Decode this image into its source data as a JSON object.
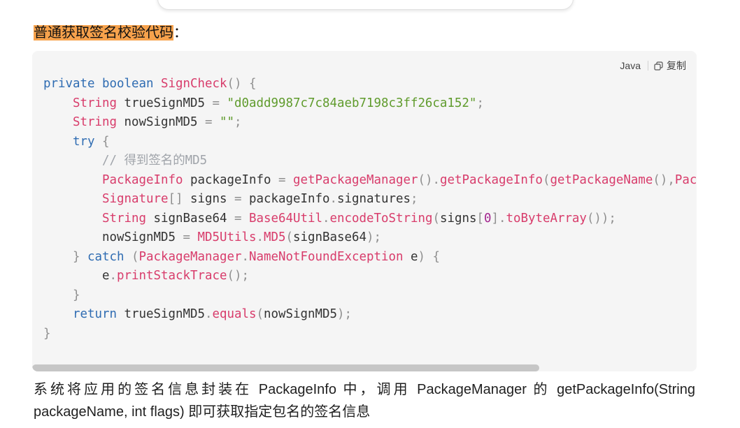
{
  "heading": {
    "highlighted": "普通获取签名校验代码",
    "suffix": "："
  },
  "colors": {
    "heading_highlight": "#f7a24c",
    "code_background": "#f5f5f5",
    "scrollbar_thumb": "#c6c6c6"
  },
  "code_block": {
    "language": "Java",
    "copy_label": "复制",
    "copy_icon": "copy-icon",
    "scroll": {
      "visible_fraction": 0.763,
      "scroll_position": 0
    },
    "lines": [
      [
        [
          "private",
          "#2f6cb2"
        ],
        [
          " ",
          "#333333"
        ],
        [
          "boolean",
          "#2f6cb2"
        ],
        [
          " ",
          "#333333"
        ],
        [
          "SignCheck",
          "#d83c6b"
        ],
        [
          "()",
          "#8f8f8f"
        ],
        [
          " ",
          "#333333"
        ],
        [
          "{",
          "#8f8f8f"
        ]
      ],
      [
        [
          "    ",
          "#333333"
        ],
        [
          "String",
          "#d83c6b"
        ],
        [
          " trueSignMD5 ",
          "#333333"
        ],
        [
          "=",
          "#8f8f8f"
        ],
        [
          " ",
          "#333333"
        ],
        [
          "\"d0add9987c7c84aeb7198c3ff26ca152\"",
          "#5f9b2c"
        ],
        [
          ";",
          "#8f8f8f"
        ]
      ],
      [
        [
          "    ",
          "#333333"
        ],
        [
          "String",
          "#d83c6b"
        ],
        [
          " nowSignMD5 ",
          "#333333"
        ],
        [
          "=",
          "#8f8f8f"
        ],
        [
          " ",
          "#333333"
        ],
        [
          "\"\"",
          "#5f9b2c"
        ],
        [
          ";",
          "#8f8f8f"
        ]
      ],
      [
        [
          "    ",
          "#333333"
        ],
        [
          "try",
          "#2f6cb2"
        ],
        [
          " ",
          "#333333"
        ],
        [
          "{",
          "#8f8f8f"
        ]
      ],
      [
        [
          "        ",
          "#333333"
        ],
        [
          "// 得到签名的MD5",
          "#a0a4aa"
        ]
      ],
      [
        [
          "        ",
          "#333333"
        ],
        [
          "PackageInfo",
          "#d83c6b"
        ],
        [
          " packageInfo ",
          "#333333"
        ],
        [
          "=",
          "#8f8f8f"
        ],
        [
          " ",
          "#333333"
        ],
        [
          "getPackageManager",
          "#d83c6b"
        ],
        [
          "().",
          "#8f8f8f"
        ],
        [
          "getPackageInfo",
          "#d83c6b"
        ],
        [
          "(",
          "#8f8f8f"
        ],
        [
          "getPackageName",
          "#d83c6b"
        ],
        [
          "(),",
          "#8f8f8f"
        ],
        [
          "Pac",
          "#d83c6b"
        ]
      ],
      [
        [
          "        ",
          "#333333"
        ],
        [
          "Signature",
          "#d83c6b"
        ],
        [
          "[]",
          "#8f8f8f"
        ],
        [
          " signs ",
          "#333333"
        ],
        [
          "=",
          "#8f8f8f"
        ],
        [
          " packageInfo",
          "#333333"
        ],
        [
          ".",
          "#8f8f8f"
        ],
        [
          "signatures",
          "#333333"
        ],
        [
          ";",
          "#8f8f8f"
        ]
      ],
      [
        [
          "        ",
          "#333333"
        ],
        [
          "String",
          "#d83c6b"
        ],
        [
          " signBase64 ",
          "#333333"
        ],
        [
          "=",
          "#8f8f8f"
        ],
        [
          " ",
          "#333333"
        ],
        [
          "Base64Util",
          "#d83c6b"
        ],
        [
          ".",
          "#8f8f8f"
        ],
        [
          "encodeToString",
          "#d83c6b"
        ],
        [
          "(",
          "#8f8f8f"
        ],
        [
          "signs",
          "#333333"
        ],
        [
          "[",
          "#8f8f8f"
        ],
        [
          "0",
          "#a3268f"
        ],
        [
          "].",
          "#8f8f8f"
        ],
        [
          "toByteArray",
          "#d83c6b"
        ],
        [
          "());",
          "#8f8f8f"
        ]
      ],
      [
        [
          "        ",
          "#333333"
        ],
        [
          "nowSignMD5 ",
          "#333333"
        ],
        [
          "=",
          "#8f8f8f"
        ],
        [
          " ",
          "#333333"
        ],
        [
          "MD5Utils",
          "#d83c6b"
        ],
        [
          ".",
          "#8f8f8f"
        ],
        [
          "MD5",
          "#d83c6b"
        ],
        [
          "(",
          "#8f8f8f"
        ],
        [
          "signBase64",
          "#333333"
        ],
        [
          ");",
          "#8f8f8f"
        ]
      ],
      [
        [
          "    ",
          "#333333"
        ],
        [
          "}",
          "#8f8f8f"
        ],
        [
          " ",
          "#333333"
        ],
        [
          "catch",
          "#2f6cb2"
        ],
        [
          " ",
          "#333333"
        ],
        [
          "(",
          "#8f8f8f"
        ],
        [
          "PackageManager",
          "#d83c6b"
        ],
        [
          ".",
          "#8f8f8f"
        ],
        [
          "NameNotFoundException",
          "#d83c6b"
        ],
        [
          " e",
          "#333333"
        ],
        [
          ")",
          "#8f8f8f"
        ],
        [
          " ",
          "#333333"
        ],
        [
          "{",
          "#8f8f8f"
        ]
      ],
      [
        [
          "        ",
          "#333333"
        ],
        [
          "e",
          "#333333"
        ],
        [
          ".",
          "#8f8f8f"
        ],
        [
          "printStackTrace",
          "#d83c6b"
        ],
        [
          "();",
          "#8f8f8f"
        ]
      ],
      [
        [
          "    ",
          "#333333"
        ],
        [
          "}",
          "#8f8f8f"
        ]
      ],
      [
        [
          "    ",
          "#333333"
        ],
        [
          "return",
          "#2f6cb2"
        ],
        [
          " trueSignMD5",
          "#333333"
        ],
        [
          ".",
          "#8f8f8f"
        ],
        [
          "equals",
          "#d83c6b"
        ],
        [
          "(",
          "#8f8f8f"
        ],
        [
          "nowSignMD5",
          "#333333"
        ],
        [
          ");",
          "#8f8f8f"
        ]
      ],
      [
        [
          "}",
          "#8f8f8f"
        ]
      ]
    ]
  },
  "paragraph": {
    "lines": [
      "系统将应用的签名信息封装在 PackageInfo 中，调用 PackageManager 的 getPackageInfo(String",
      "packageName, int flags) 即可获取指定包名的签名信息"
    ]
  }
}
